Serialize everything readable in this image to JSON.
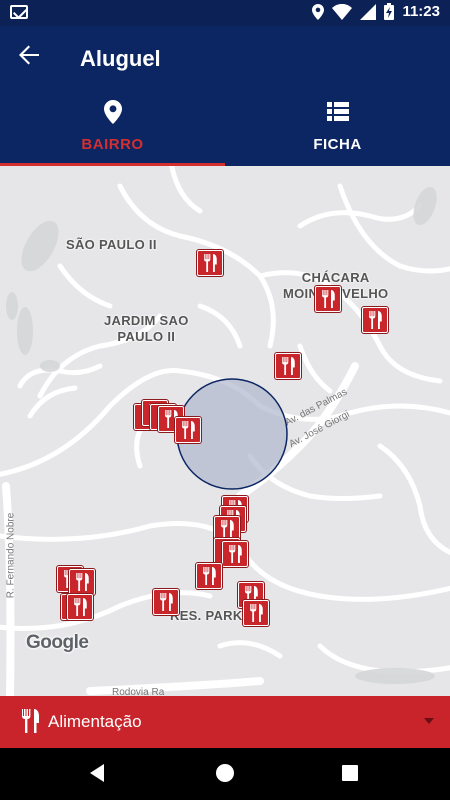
{
  "status_bar": {
    "time": "11:23"
  },
  "app_bar": {
    "title": "Aluguel"
  },
  "tabs": [
    {
      "label": "BAIRRO",
      "icon": "location-pin-icon",
      "active": true
    },
    {
      "label": "FICHA",
      "icon": "list-icon",
      "active": false
    }
  ],
  "map": {
    "places": {
      "sao_paulo_ii": "SÃO PAULO II",
      "jardim_1": "JARDIM SAO",
      "jardim_2": "PAULO II",
      "chacara_1": "CHÁCARA",
      "chacara_2": "MOINHO VELHO",
      "res_park": "RES. PARK"
    },
    "roads": {
      "palmas": "Av. das Palmas",
      "jose_giorgi": "Av. José Giorgi",
      "fernando_nobre": "R. Fernando Nobre",
      "rodovia": "Rodovia Ra"
    },
    "attribution": "Google",
    "marker_icon": "restaurant-icon",
    "marker_count": 22
  },
  "category_selector": {
    "label": "Alimentação",
    "icon": "fork-knife-icon"
  },
  "colors": {
    "primary": "#0c2663",
    "accent": "#d32f2f",
    "marker": "#c9262c",
    "map_bg": "#e6e6e8"
  }
}
